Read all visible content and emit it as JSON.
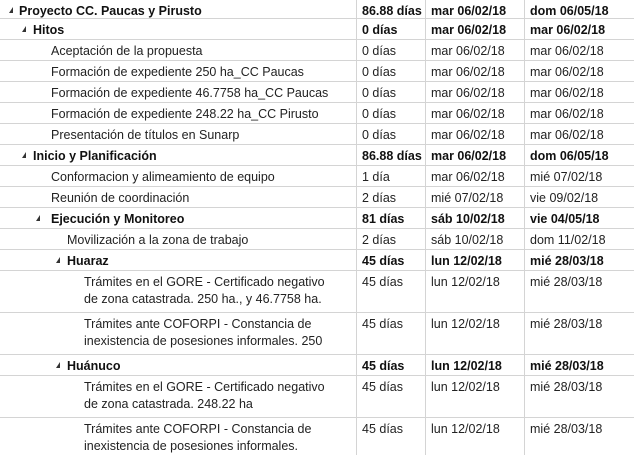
{
  "tasks": [
    {
      "name": "Proyecto CC. Paucas y Pirusto",
      "duration": "86.88 días",
      "start": "mar 06/02/18",
      "end": "dom 06/05/18",
      "level": 0,
      "summary": true
    },
    {
      "name": "Hitos",
      "duration": "0 días",
      "start": "mar 06/02/18",
      "end": "mar 06/02/18",
      "level": 1,
      "summary": true
    },
    {
      "name": "Aceptación de la propuesta",
      "duration": "0 días",
      "start": "mar 06/02/18",
      "end": "mar 06/02/18",
      "level": 2,
      "summary": false
    },
    {
      "name": "Formación de expediente 250 ha_CC Paucas",
      "duration": "0 días",
      "start": "mar 06/02/18",
      "end": "mar 06/02/18",
      "level": 2,
      "summary": false
    },
    {
      "name": "Formación de expediente 46.7758 ha_CC Paucas",
      "duration": "0 días",
      "start": "mar 06/02/18",
      "end": "mar 06/02/18",
      "level": 2,
      "summary": false
    },
    {
      "name": "Formación de expediente 248.22 ha_CC Pirusto",
      "duration": "0 días",
      "start": "mar 06/02/18",
      "end": "mar 06/02/18",
      "level": 2,
      "summary": false
    },
    {
      "name": "Presentación de títulos en Sunarp",
      "duration": "0 días",
      "start": "mar 06/02/18",
      "end": "mar 06/02/18",
      "level": 2,
      "summary": false
    },
    {
      "name": "Inicio y Planificación",
      "duration": "86.88 días",
      "start": "mar 06/02/18",
      "end": "dom 06/05/18",
      "level": 1,
      "summary": true
    },
    {
      "name": "Conformacion y alimeamiento de equipo",
      "duration": "1 día",
      "start": "mar 06/02/18",
      "end": "mié 07/02/18",
      "level": 2,
      "summary": false
    },
    {
      "name": "Reunión de coordinación",
      "duration": "2 días",
      "start": "mié 07/02/18",
      "end": "vie 09/02/18",
      "level": 2,
      "summary": false
    },
    {
      "name": "Ejecución y Monitoreo",
      "duration": "81 días",
      "start": "sáb 10/02/18",
      "end": "vie 04/05/18",
      "level": 2,
      "summary": true
    },
    {
      "name": "Movilización a la zona de trabajo",
      "duration": "2 días",
      "start": "sáb 10/02/18",
      "end": "dom 11/02/18",
      "level": 3,
      "summary": false
    },
    {
      "name": "Huaraz",
      "duration": "45 días",
      "start": "lun 12/02/18",
      "end": "mié 28/03/18",
      "level": 3,
      "summary": true
    },
    {
      "name": "Trámites en el GORE - Certificado negativo de zona catastrada. 250 ha., y 46.7758 ha.",
      "duration": "45 días",
      "start": "lun 12/02/18",
      "end": "mié 28/03/18",
      "level": 4,
      "summary": false
    },
    {
      "name": "Trámites ante COFORPI - Constancia de inexistencia de posesiones informales. 250",
      "duration": "45 días",
      "start": "lun 12/02/18",
      "end": "mié 28/03/18",
      "level": 4,
      "summary": false
    },
    {
      "name": "Huánuco",
      "duration": "45 días",
      "start": "lun 12/02/18",
      "end": "mié 28/03/18",
      "level": 3,
      "summary": true
    },
    {
      "name": "Trámites en el GORE - Certificado negativo de zona catastrada. 248.22 ha",
      "duration": "45 días",
      "start": "lun 12/02/18",
      "end": "mié 28/03/18",
      "level": 4,
      "summary": false
    },
    {
      "name": "Trámites ante COFORPI - Constancia de inexistencia de posesiones informales.",
      "duration": "45 días",
      "start": "lun 12/02/18",
      "end": "mié 28/03/18",
      "level": 4,
      "summary": false
    }
  ],
  "collapse_icon": "collapse-triangle-icon"
}
